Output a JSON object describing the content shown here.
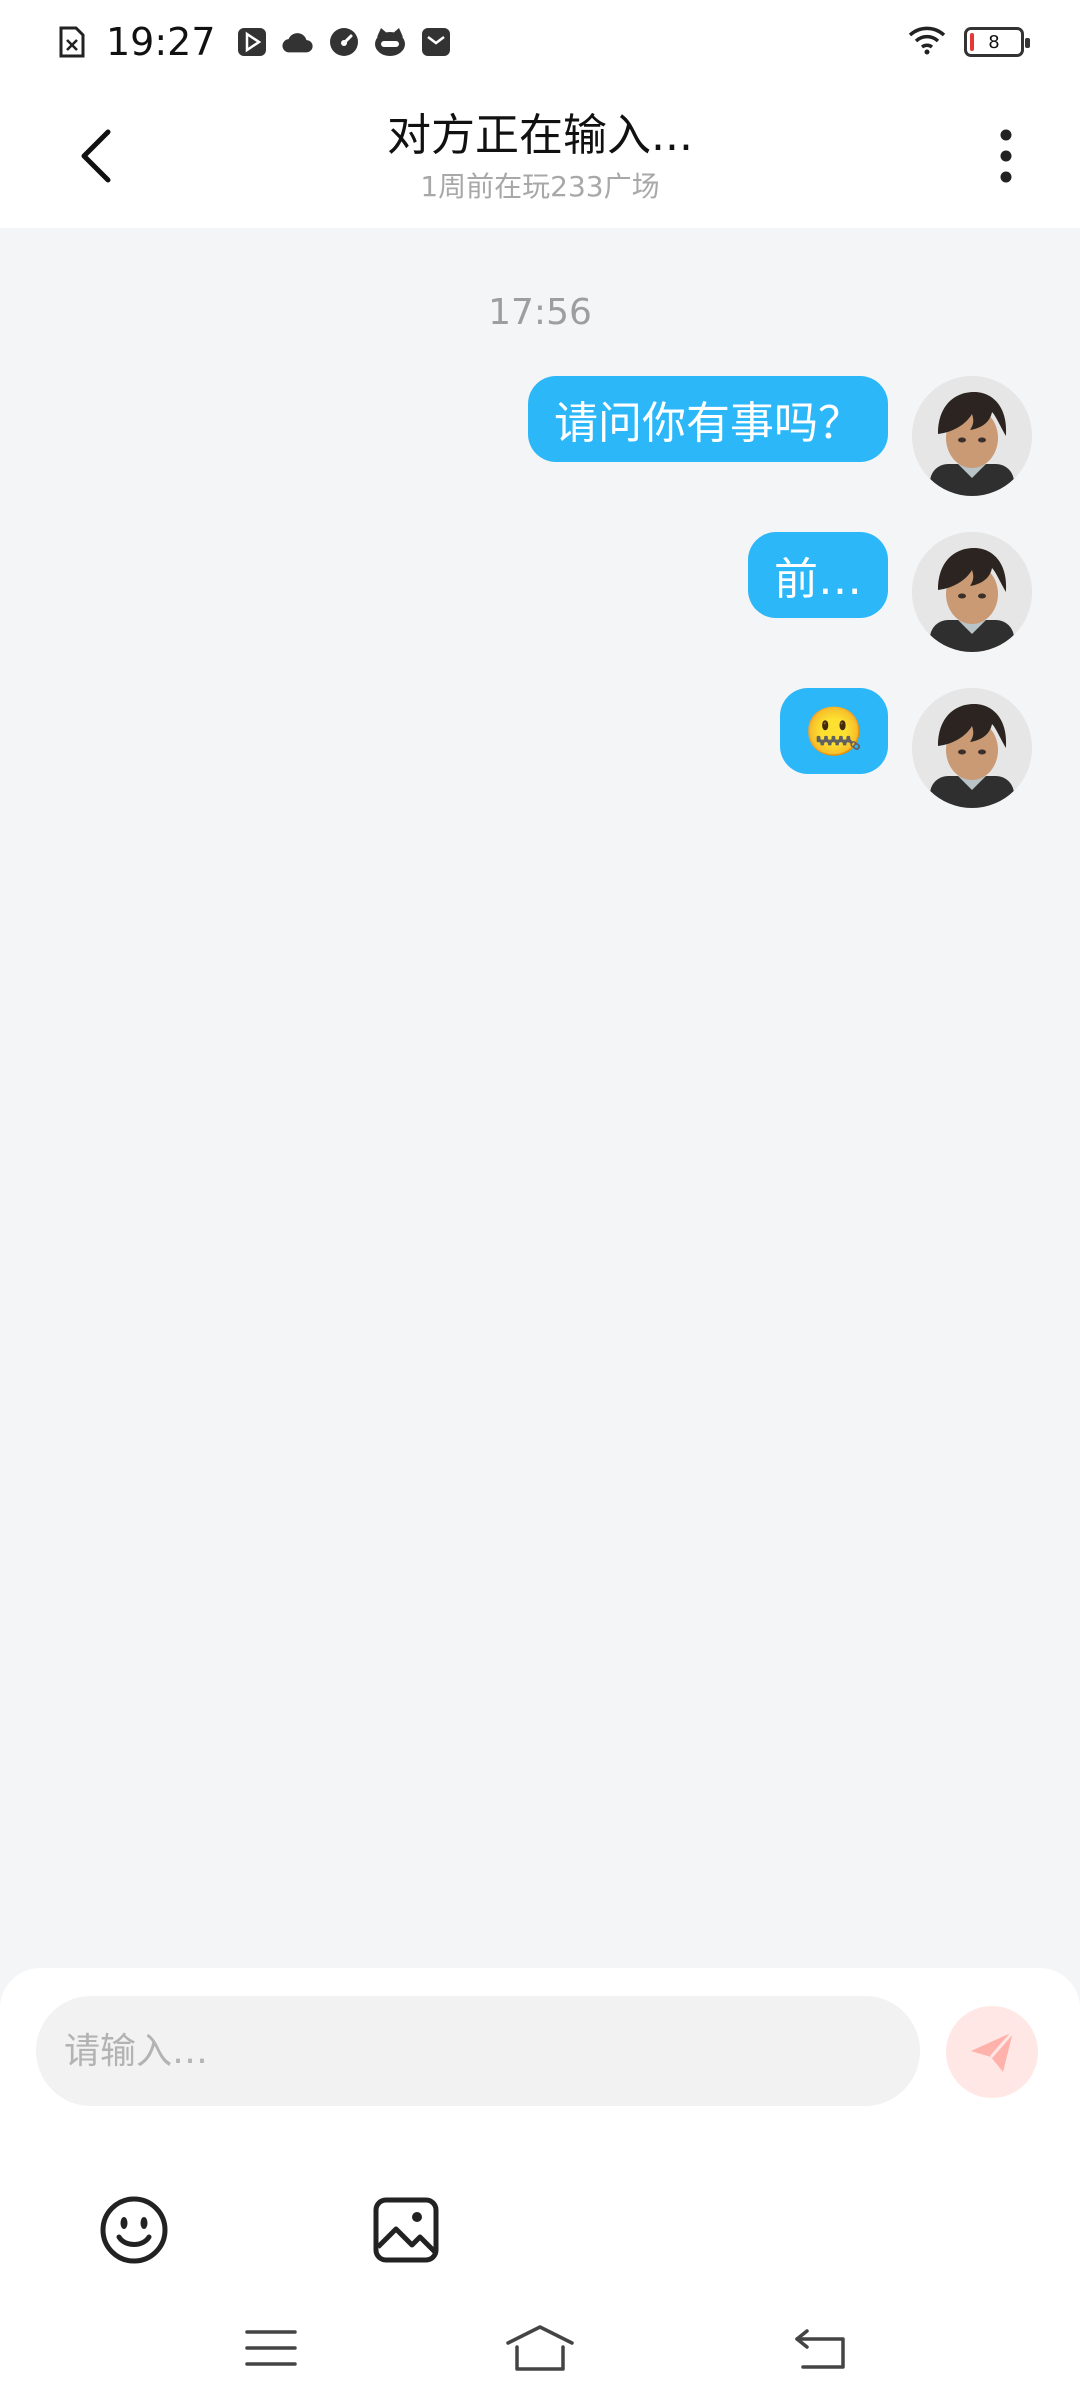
{
  "status_bar": {
    "time": "19:27",
    "battery_level": "8",
    "left_icons": [
      "sim-error-icon",
      "play-store-icon",
      "cloud-icon",
      "speedometer-icon",
      "cat-app-icon",
      "mail-icon"
    ],
    "right_icons": [
      "wifi-icon",
      "battery-icon"
    ]
  },
  "header": {
    "title": "对方正在输入...",
    "subtitle": "1周前在玩233广场",
    "back_icon": "chevron-left-icon",
    "more_icon": "more-vertical-icon"
  },
  "chat": {
    "timestamp": "17:56",
    "messages": [
      {
        "text": "请问你有事吗？",
        "sender": "self"
      },
      {
        "text": "前…",
        "sender": "self"
      },
      {
        "text": "🤐",
        "sender": "self"
      }
    ]
  },
  "composer": {
    "placeholder": "请输入…",
    "value": "",
    "send_icon": "send-icon",
    "tools": [
      "emoji-icon",
      "image-icon"
    ]
  },
  "nav_bar": {
    "icons": [
      "menu-icon",
      "home-icon",
      "back-icon"
    ]
  },
  "colors": {
    "bubble": "#2cb7f9",
    "background": "#f4f5f7",
    "send_button_bg": "#ffe7e6",
    "send_icon": "#ffb2ab"
  }
}
